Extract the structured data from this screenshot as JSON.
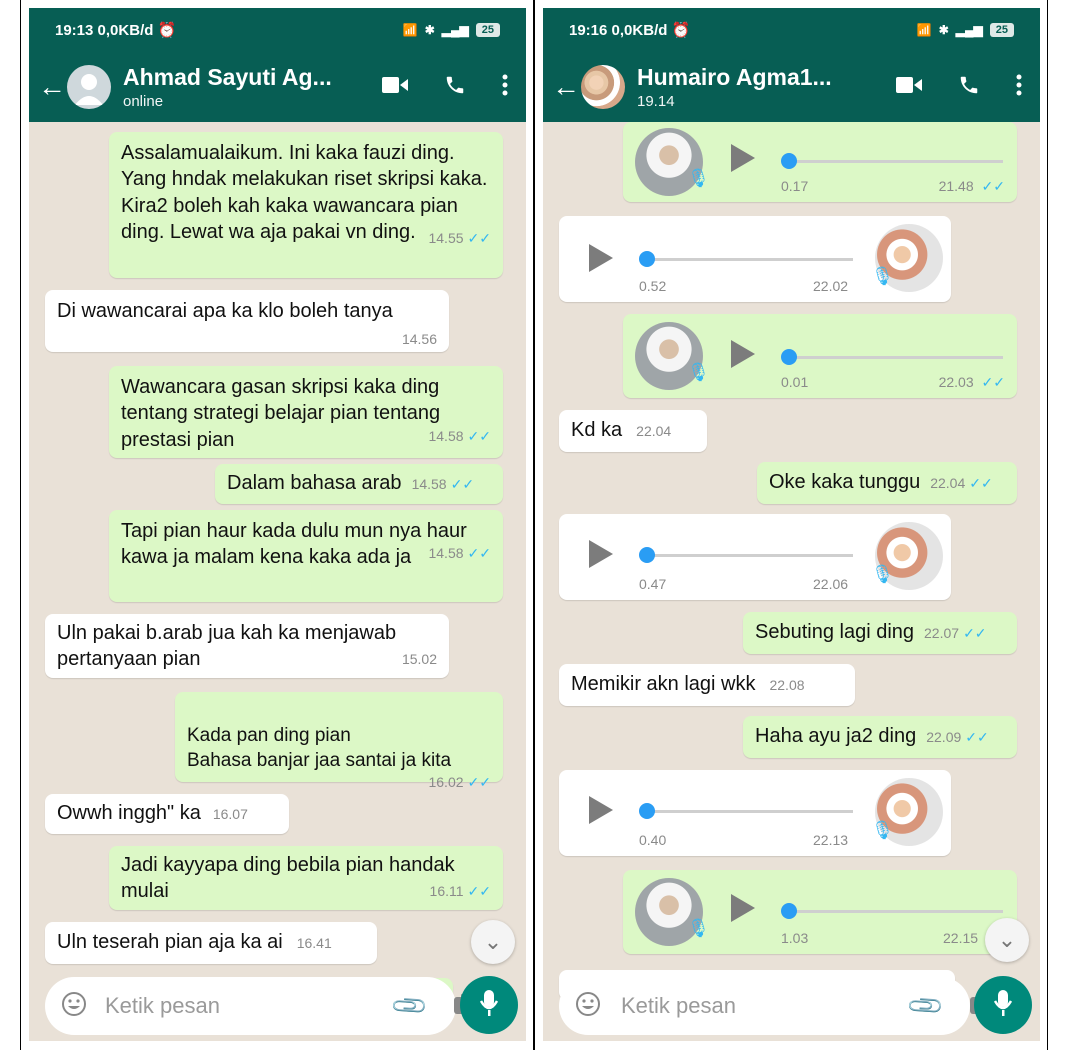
{
  "left": {
    "status": {
      "time": "19:13",
      "speed": "0,0KB/d",
      "battery": "25"
    },
    "header": {
      "name": "Ahmad Sayuti Ag...",
      "status": "online"
    },
    "messages": [
      {
        "text": "Assalamualaikum. Ini kaka fauzi ding. Yang hndak melakukan riset skripsi kaka. Kira2 boleh kah kaka wawancara pian ding. Lewat wa aja pakai vn ding.",
        "time": "14.55"
      },
      {
        "text": "Di wawancarai apa ka klo boleh tanya",
        "time": "14.56"
      },
      {
        "text": "Wawancara gasan skripsi kaka ding tentang strategi belajar pian tentang prestasi pian",
        "time": "14.58"
      },
      {
        "text": "Dalam bahasa arab",
        "time": "14.58"
      },
      {
        "text": "Tapi pian haur kada dulu mun nya haur kawa ja malam kena kaka ada ja",
        "time": "14.58"
      },
      {
        "text": "Uln pakai b.arab jua kah ka menjawab pertanyaan pian",
        "time": "15.02"
      },
      {
        "text": "Kada pan ding pian\nBahasa banjar jaa santai ja kita",
        "time": "16.02"
      },
      {
        "text": "Owwh inggh\" ka",
        "time": "16.07"
      },
      {
        "text": "Jadi kayyapa ding bebila pian handak mulai",
        "time": "16.11"
      },
      {
        "text": "Uln teserah pian aja ka ai",
        "time": "16.41"
      }
    ],
    "input_placeholder": "Ketik pesan"
  },
  "right": {
    "status": {
      "time": "19:16",
      "speed": "0,0KB/d",
      "battery": "25"
    },
    "header": {
      "name": "Humairo Agma1...",
      "status": "19.14"
    },
    "voices": [
      {
        "duration": "0.17",
        "time": "21.48"
      },
      {
        "duration": "0.52",
        "time": "22.02"
      },
      {
        "duration": "0.01",
        "time": "22.03"
      },
      {
        "duration": "0.47",
        "time": "22.06"
      },
      {
        "duration": "0.40",
        "time": "22.13"
      },
      {
        "duration": "1.03",
        "time": "22.15"
      }
    ],
    "texts": [
      {
        "text": "Kd ka",
        "time": "22.04"
      },
      {
        "text": "Oke kaka tunggu",
        "time": "22.04"
      },
      {
        "text": "Sebuting lagi ding",
        "time": "22.07"
      },
      {
        "text": "Memikir akn lagi wkk",
        "time": "22.08"
      },
      {
        "text": "Haha ayu ja2 ding",
        "time": "22.09"
      }
    ],
    "input_placeholder": "Ketik pesan"
  },
  "colors": {
    "header": "#075e54",
    "outgoing": "#dcf8c6",
    "incoming": "#ffffff",
    "chat_bg": "#e9e1d7",
    "tick": "#34b7f1",
    "mic_button": "#00897b"
  }
}
